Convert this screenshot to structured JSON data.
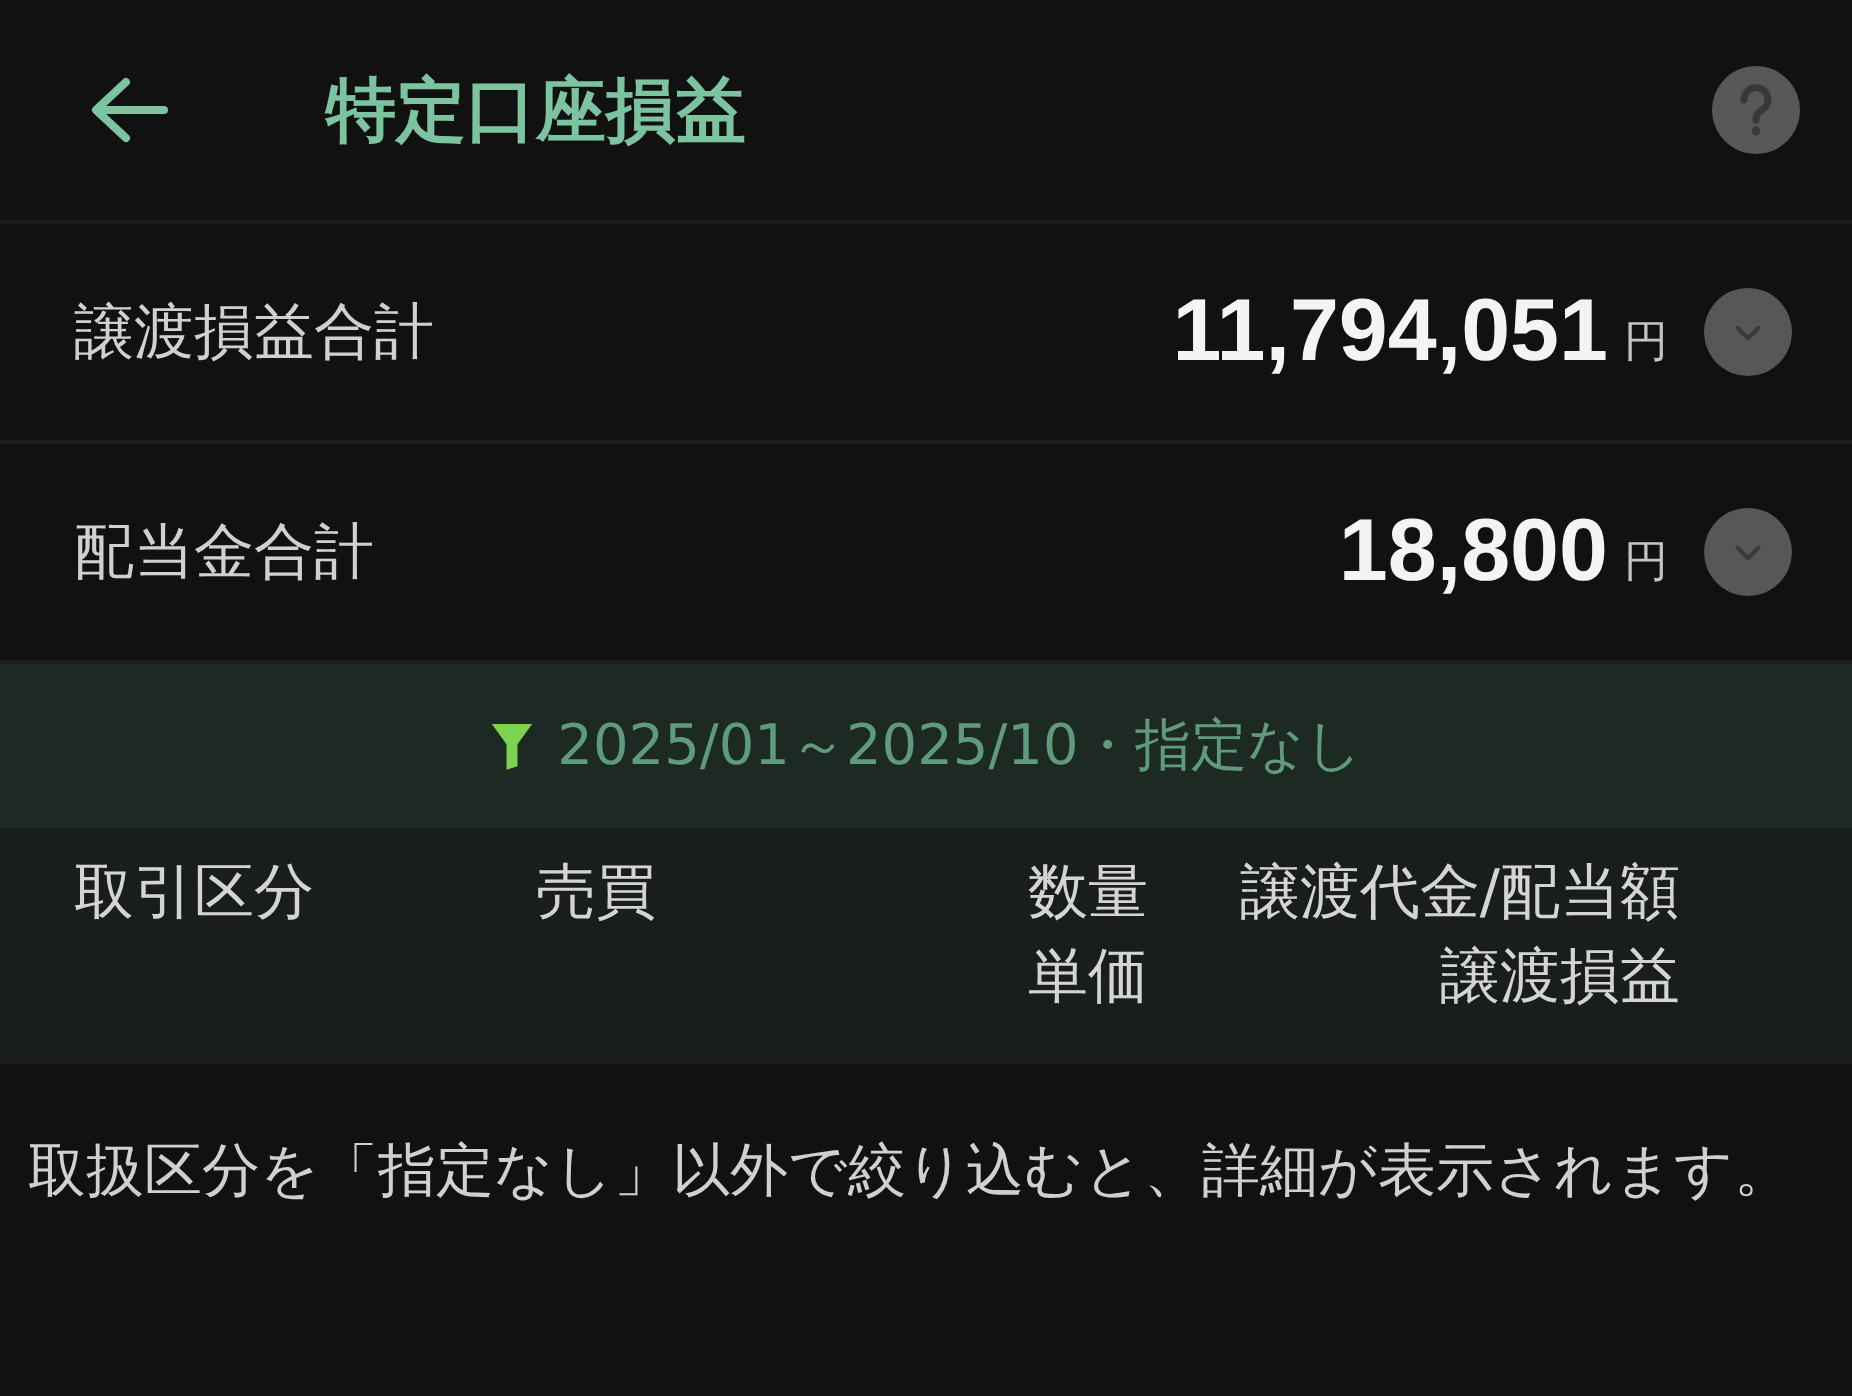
{
  "header": {
    "title": "特定口座損益"
  },
  "summary": [
    {
      "label": "譲渡損益合計",
      "amount": "11,794,051",
      "unit": "円",
      "expanded": false
    },
    {
      "label": "配当金合計",
      "amount": "18,800",
      "unit": "円",
      "expanded": false
    }
  ],
  "filter": {
    "text": "2025/01～2025/10・指定なし"
  },
  "table_header": {
    "columns": [
      {
        "lines": [
          "取引区分"
        ]
      },
      {
        "lines": [
          "売買"
        ]
      },
      {
        "lines": [
          "数量",
          "単価"
        ]
      },
      {
        "lines": [
          "譲渡代金/配当額",
          "譲渡損益"
        ]
      }
    ]
  },
  "message": "取扱区分を「指定なし」以外で絞り込むと、詳細が表示されます。"
}
